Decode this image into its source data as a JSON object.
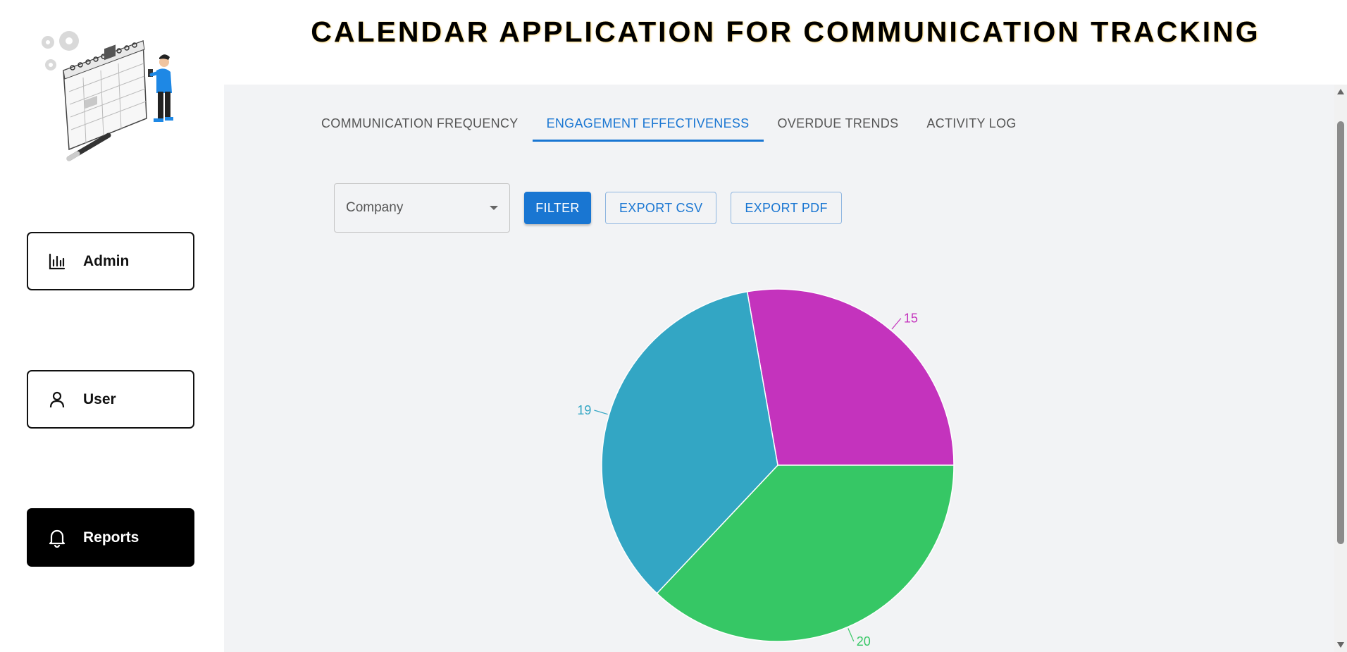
{
  "header": {
    "title": "CALENDAR APPLICATION FOR COMMUNICATION TRACKING"
  },
  "sidebar": {
    "items": [
      {
        "label": "Admin",
        "icon": "bar-chart-icon",
        "active": false
      },
      {
        "label": "User",
        "icon": "person-icon",
        "active": false
      },
      {
        "label": "Reports",
        "icon": "bell-icon",
        "active": true
      }
    ]
  },
  "tabs": [
    {
      "label": "COMMUNICATION FREQUENCY",
      "active": false
    },
    {
      "label": "ENGAGEMENT EFFECTIVENESS",
      "active": true
    },
    {
      "label": "OVERDUE TRENDS",
      "active": false
    },
    {
      "label": "ACTIVITY LOG",
      "active": false
    }
  ],
  "filters": {
    "company_select": {
      "value": "Company"
    },
    "filter_label": "FILTER",
    "export_csv_label": "EXPORT CSV",
    "export_pdf_label": "EXPORT PDF"
  },
  "colors": {
    "accent": "#1976d2",
    "slice_magenta": "#c433bd",
    "slice_green": "#36c765",
    "slice_blue": "#33a6c4"
  },
  "chart_data": {
    "type": "pie",
    "title": "",
    "values": [
      15,
      20,
      19
    ],
    "labels": [
      "15",
      "20",
      "19"
    ],
    "colors": [
      "#c433bd",
      "#36c765",
      "#33a6c4"
    ]
  }
}
